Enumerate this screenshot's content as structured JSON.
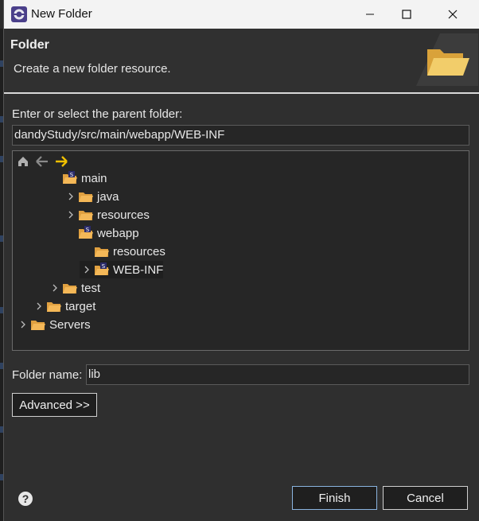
{
  "window": {
    "title": "New Folder"
  },
  "header": {
    "title": "Folder",
    "description": "Create a new folder resource."
  },
  "parent": {
    "label": "Enter or select the parent folder:",
    "value": "dandyStudy/src/main/webapp/WEB-INF"
  },
  "tree": {
    "items": [
      {
        "label": "main",
        "expanded": true,
        "badge": true
      },
      {
        "label": "java",
        "expanded": false,
        "badge": false
      },
      {
        "label": "resources",
        "expanded": false,
        "badge": false
      },
      {
        "label": "webapp",
        "expanded": true,
        "badge": true
      },
      {
        "label": "resources",
        "expanded": false,
        "badge": false
      },
      {
        "label": "WEB-INF",
        "expanded": false,
        "badge": true,
        "selected": true
      },
      {
        "label": "test",
        "expanded": false,
        "badge": false
      },
      {
        "label": "target",
        "expanded": false,
        "badge": false
      },
      {
        "label": "Servers",
        "expanded": false,
        "badge": false
      }
    ]
  },
  "folder_name": {
    "label": "Folder name:",
    "value": "lib"
  },
  "buttons": {
    "advanced": "Advanced >>",
    "finish": "Finish",
    "cancel": "Cancel"
  },
  "colors": {
    "folder": "#e0a040",
    "accent": "#f0c000",
    "selection": "#1f1f1f"
  }
}
